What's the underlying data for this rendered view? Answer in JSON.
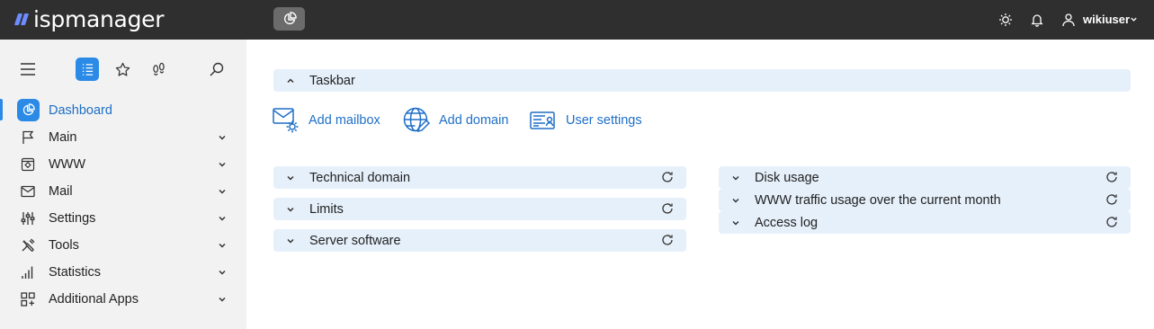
{
  "app": {
    "logo_text": "ispmanager",
    "brand_color": "#6d8cff",
    "accent_color": "#2b8ae6"
  },
  "topbar": {
    "dashboard_chip_icon": "dashboard-pie-icon",
    "theme_icon": "sun-icon",
    "notifications_icon": "bell-icon",
    "user_icon": "user-icon",
    "user_name": "wikiuser"
  },
  "sidebar": {
    "tools": [
      "hamburger-icon",
      "list-icon",
      "star-icon",
      "footprints-icon",
      "search-icon"
    ],
    "items": [
      {
        "label": "Dashboard",
        "icon": "dashboard-pie-icon",
        "active": true
      },
      {
        "label": "Main",
        "icon": "flag-icon"
      },
      {
        "label": "WWW",
        "icon": "www-gear-icon"
      },
      {
        "label": "Mail",
        "icon": "envelope-icon"
      },
      {
        "label": "Settings",
        "icon": "sliders-icon"
      },
      {
        "label": "Tools",
        "icon": "tools-icon"
      },
      {
        "label": "Statistics",
        "icon": "bar-chart-icon"
      },
      {
        "label": "Additional Apps",
        "icon": "apps-grid-icon"
      }
    ]
  },
  "main": {
    "taskbar": {
      "title": "Taskbar",
      "tasks": [
        {
          "label": "Add mailbox",
          "icon": "mail-settings-icon"
        },
        {
          "label": "Add domain",
          "icon": "globe-edit-icon"
        },
        {
          "label": "User settings",
          "icon": "user-settings-icon"
        }
      ]
    },
    "left_panels": [
      {
        "title": "Technical domain"
      },
      {
        "title": "Limits"
      },
      {
        "title": "Server software"
      }
    ],
    "right_panels": [
      {
        "title": "Disk usage"
      },
      {
        "title": "WWW traffic usage over the current month"
      },
      {
        "title": "Access log"
      }
    ]
  }
}
